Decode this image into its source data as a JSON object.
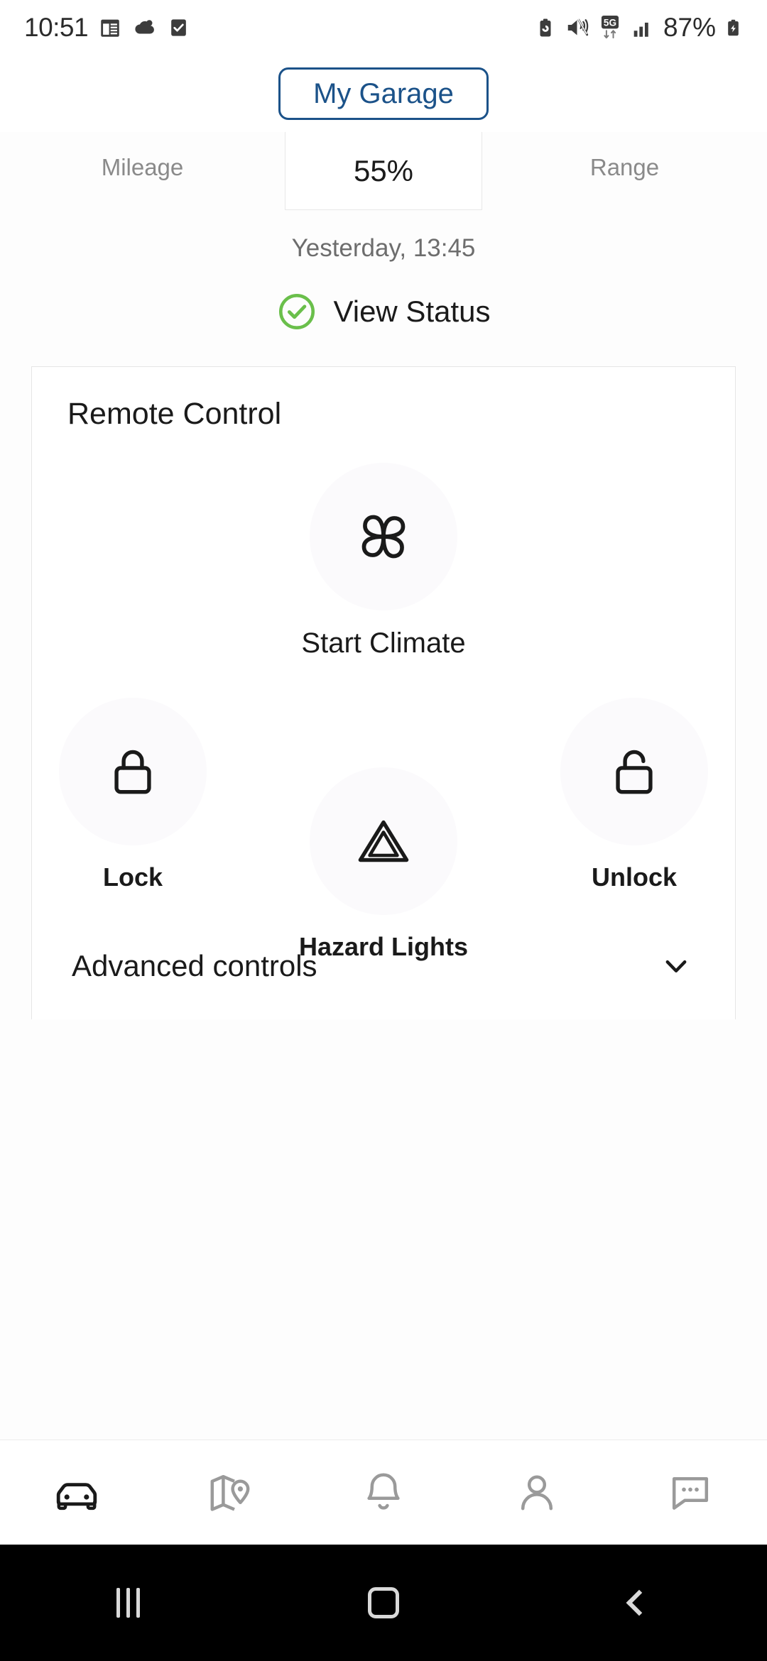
{
  "status_bar": {
    "time": "10:51",
    "battery_percent": "87%",
    "left_icons": [
      "calendar-icon",
      "weather-cloud-icon",
      "checkbox-icon"
    ],
    "right_icons": [
      "battery-saver-icon",
      "mute-vibrate-icon",
      "network-5g-icon",
      "signal-bars-icon",
      "battery-charging-icon"
    ],
    "network": "5G"
  },
  "header": {
    "garage_button": "My Garage",
    "accent_color": "#1b5289"
  },
  "stats": {
    "left_label": "Mileage",
    "center_value": "55%",
    "right_label": "Range"
  },
  "timestamp": "Yesterday, 13:45",
  "status_link": {
    "label": "View Status",
    "icon": "check-circle-icon",
    "icon_color": "#6abf4b"
  },
  "remote_control": {
    "title": "Remote Control",
    "primary": {
      "label": "Start Climate",
      "icon": "fan-icon"
    },
    "controls": [
      {
        "label": "Lock",
        "icon": "lock-closed-icon"
      },
      {
        "label": "Hazard Lights",
        "icon": "hazard-triangle-icon"
      },
      {
        "label": "Unlock",
        "icon": "lock-open-icon"
      }
    ],
    "advanced": {
      "label": "Advanced controls",
      "icon": "chevron-down-icon"
    }
  },
  "bottom_nav": [
    {
      "name": "car",
      "icon": "car-icon",
      "active": true
    },
    {
      "name": "map",
      "icon": "map-pin-icon",
      "active": false
    },
    {
      "name": "notifications",
      "icon": "bell-icon",
      "active": false
    },
    {
      "name": "profile",
      "icon": "person-icon",
      "active": false
    },
    {
      "name": "messages",
      "icon": "chat-bubble-icon",
      "active": false
    }
  ],
  "android_nav": {
    "recents": "|||",
    "home": "home-square",
    "back": "back-chevron"
  }
}
